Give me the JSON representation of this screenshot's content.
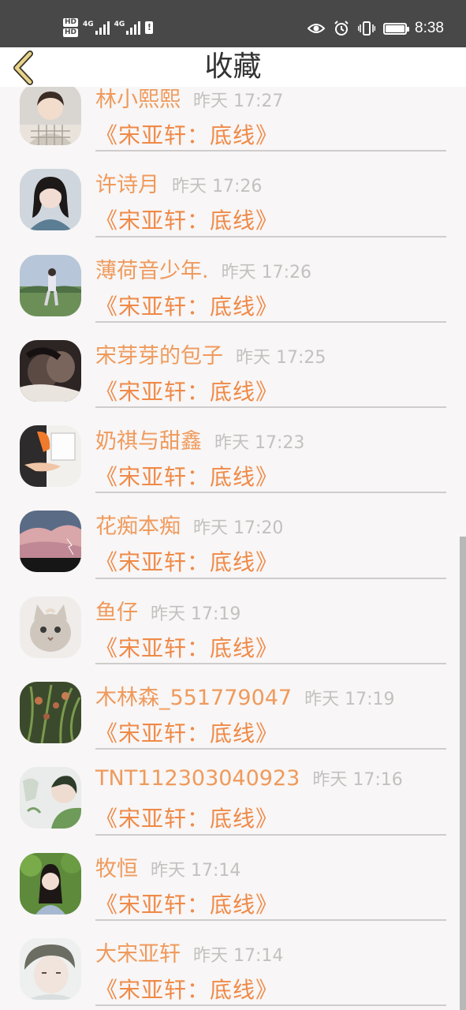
{
  "status_bar": {
    "hd1": "HD",
    "hd2": "HD",
    "net1": "4G",
    "net2": "4G",
    "battery_alert": "!",
    "time": "8:38"
  },
  "header": {
    "title": "收藏",
    "back_icon": "chevron-left-icon"
  },
  "colors": {
    "name": "#ef9a5c",
    "book": "#ef8a48",
    "time": "#c4c0c0",
    "back_arrow": "#e8d38a"
  },
  "items": [
    {
      "name": "林小熙熙",
      "time": "昨天 17:27",
      "book": "《宋亚轩：底线》",
      "avatar": "portrait-plaid"
    },
    {
      "name": "许诗月",
      "time": "昨天 17:26",
      "book": "《宋亚轩：底线》",
      "avatar": "portrait-girl"
    },
    {
      "name": "薄荷音少年.",
      "time": "昨天 17:26",
      "book": "《宋亚轩：底线》",
      "avatar": "field-figure"
    },
    {
      "name": "宋芽芽的包子",
      "time": "昨天 17:25",
      "book": "《宋亚轩：底线》",
      "avatar": "couple-dark"
    },
    {
      "name": "奶祺与甜鑫",
      "time": "昨天 17:23",
      "book": "《宋亚轩：底线》",
      "avatar": "hands-orange"
    },
    {
      "name": "花痴本痴",
      "time": "昨天 17:20",
      "book": "《宋亚轩：底线》",
      "avatar": "pink-sky"
    },
    {
      "name": "鱼仔",
      "time": "昨天 17:19",
      "book": "《宋亚轩：底线》",
      "avatar": "cat"
    },
    {
      "name": "木林森_551779047",
      "time": "昨天 17:19",
      "book": "《宋亚轩：底线》",
      "avatar": "green-plant"
    },
    {
      "name": "TNT112303040923",
      "time": "昨天 17:16",
      "book": "《宋亚轩：底线》",
      "avatar": "boy-green"
    },
    {
      "name": "牧恒",
      "time": "昨天 17:14",
      "book": "《宋亚轩：底线》",
      "avatar": "girl-outdoor"
    },
    {
      "name": "大宋亚轩",
      "time": "昨天 17:14",
      "book": "《宋亚轩：底线》",
      "avatar": "boy-pale"
    }
  ]
}
